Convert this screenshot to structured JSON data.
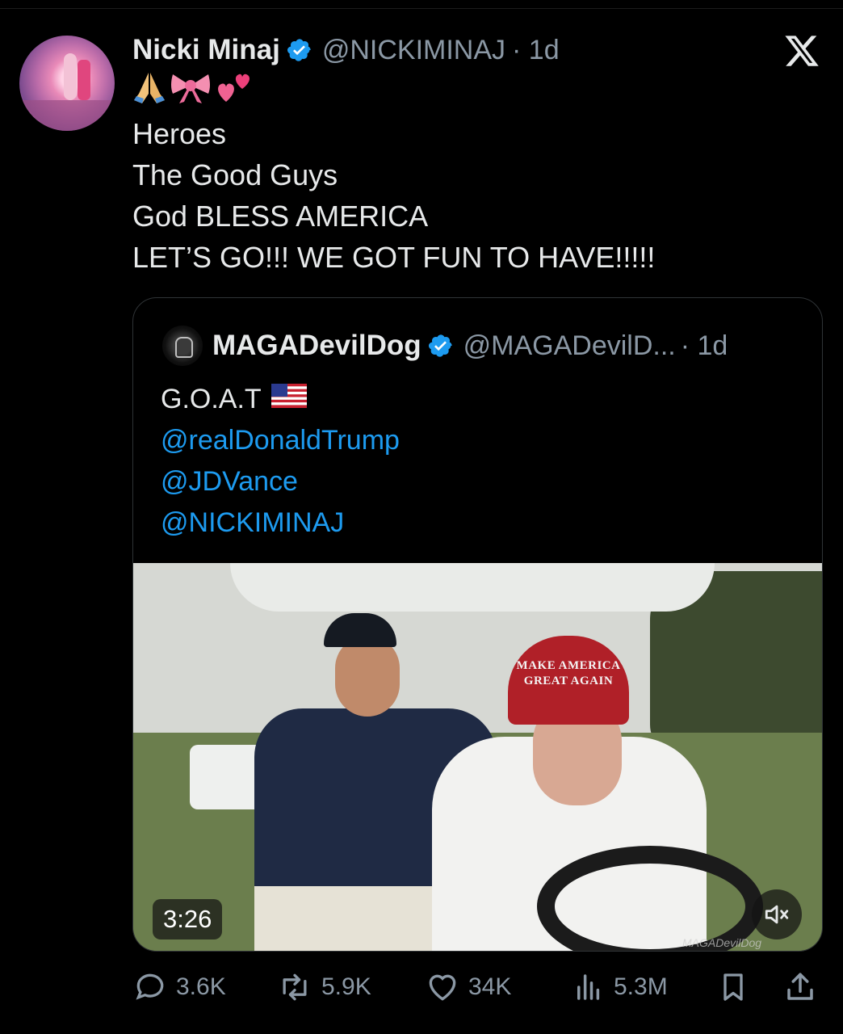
{
  "post": {
    "author_name": "Nicki Minaj",
    "author_handle": "@NICKIMINAJ",
    "age": "· 1d",
    "emojis": [
      "folded-hands",
      "ribbon",
      "two-hearts"
    ],
    "lines": [
      "Heroes",
      "The Good Guys",
      "God BLESS AMERICA",
      "LET’S GO!!! WE GOT FUN TO HAVE!!!!!"
    ]
  },
  "quote": {
    "author_name": "MAGADevilDog",
    "author_handle": "@MAGADevilD...",
    "age": "· 1d",
    "text": "G.O.A.T",
    "mentions": [
      "@realDonaldTrump",
      "@JDVance",
      "@NICKIMINAJ"
    ],
    "video": {
      "duration": "3:26",
      "cap_text": "MAKE AMERICA GREAT AGAIN",
      "watermark": "MAGADevilDog"
    }
  },
  "actions": {
    "replies": "3.6K",
    "reposts": "5.9K",
    "likes": "34K",
    "views": "5.3M"
  },
  "colors": {
    "background": "#000000",
    "text": "#e7e9ea",
    "muted": "#8b98a5",
    "link": "#1d9bf0",
    "verified": "#1d9bf0"
  }
}
